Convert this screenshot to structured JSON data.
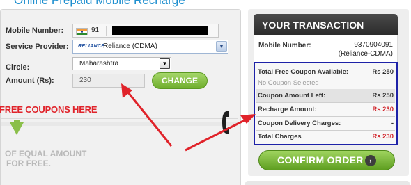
{
  "page": {
    "title": "Online Prepaid Mobile Recharge"
  },
  "form": {
    "mobile_label": "Mobile Number:",
    "country_code": "91",
    "service_label": "Service Provider:",
    "provider_logo": "RELIANCE",
    "provider_value": "Reliance (CDMA)",
    "circle_label": "Circle:",
    "circle_value": "Maharashtra",
    "amount_label": "Amount (Rs):",
    "amount_value": "230",
    "change_label": "CHANGE"
  },
  "promo": {
    "free_coupons": "FREE COUPONS HERE",
    "equal_amount_line1": "OF EQUAL AMOUNT",
    "equal_amount_line2": "FOR FREE."
  },
  "transaction": {
    "header": "YOUR TRANSACTION",
    "mobile_label": "Mobile Number:",
    "mobile_value": "9370904091",
    "provider": "(Reliance-CDMA)",
    "rows": [
      {
        "label": "Total Free Coupon Available:",
        "value": "Rs 250"
      },
      {
        "label": "No Coupon Selected",
        "value": ""
      },
      {
        "label": "Coupon Amount Left:",
        "value": "Rs 250"
      },
      {
        "label": "Recharge Amount:",
        "value": "Rs 230"
      },
      {
        "label": "Coupon Delivery Charges:",
        "value": "-"
      },
      {
        "label": "Total Charges",
        "value": "Rs 230"
      }
    ],
    "confirm_label": "CONFIRM ORDER",
    "confirm_chevron": "›"
  },
  "colors": {
    "accent_green": "#6fae2c",
    "highlight_border": "#1e22a8",
    "annotation_red": "#e0232a",
    "title_blue": "#1e8fcf"
  },
  "icons": {
    "flag": "india-flag-icon",
    "provider_dropdown": "chevron-down-icon",
    "circle_dropdown": "caret-down-icon",
    "confirm": "chevron-right-icon",
    "phone": "phone-icon",
    "down": "arrow-down-icon"
  }
}
